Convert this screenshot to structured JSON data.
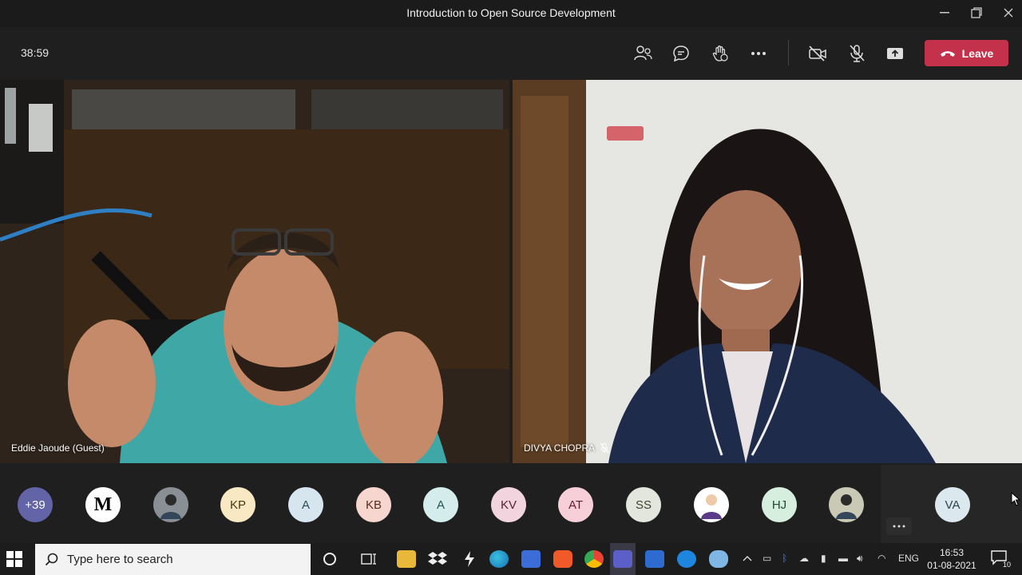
{
  "window": {
    "title": "Introduction to Open Source Development"
  },
  "meeting": {
    "timer": "38:59",
    "leave_label": "Leave"
  },
  "tiles": [
    {
      "name": "Eddie Jaoude (Guest)"
    },
    {
      "name": "DIVYA CHOPRA",
      "muted": true
    }
  ],
  "participants": [
    {
      "label": "+39",
      "bg": "#6264a7",
      "fg": "#ffffff"
    },
    {
      "label": "M",
      "bg": "#ffffff",
      "fg": "#000000"
    },
    {
      "label": "",
      "bg": "#8a8f96",
      "fg": "#000000",
      "icon": "photo-avatar"
    },
    {
      "label": "KP",
      "bg": "#f8e8c4",
      "fg": "#4a3a10"
    },
    {
      "label": "A",
      "bg": "#d7e6ee",
      "fg": "#2b4a5a"
    },
    {
      "label": "KB",
      "bg": "#f6d6cf",
      "fg": "#5a2a20"
    },
    {
      "label": "A",
      "bg": "#d4ecec",
      "fg": "#235252"
    },
    {
      "label": "KV",
      "bg": "#f2d4de",
      "fg": "#5a2035"
    },
    {
      "label": "AT",
      "bg": "#f7cfd9",
      "fg": "#6a1a30"
    },
    {
      "label": "SS",
      "bg": "#e3e6dc",
      "fg": "#3d4430"
    },
    {
      "label": "",
      "bg": "#ffffff",
      "fg": "#000000",
      "icon": "graduate-avatar"
    },
    {
      "label": "HJ",
      "bg": "#d5eedd",
      "fg": "#1f4a2c"
    },
    {
      "label": "",
      "bg": "#c9c9b5",
      "fg": "#000000",
      "icon": "photo-avatar"
    },
    {
      "label": "VA",
      "bg": "#dbe8ee",
      "fg": "#2b4350"
    }
  ],
  "taskbar": {
    "search_placeholder": "Type here to search",
    "language": "ENG",
    "time": "16:53",
    "date": "01-08-2021",
    "notification_count": "10"
  },
  "colors": {
    "leave": "#c4314b",
    "teams_purple": "#6264a7"
  }
}
